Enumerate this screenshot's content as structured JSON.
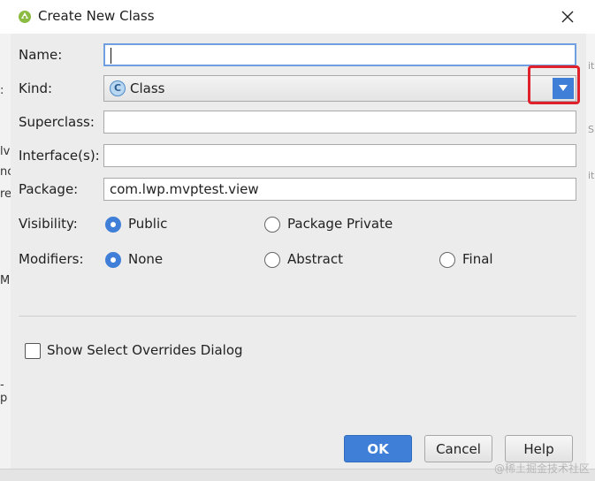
{
  "window": {
    "title": "Create New Class"
  },
  "form": {
    "name": {
      "label": "Name:",
      "value": ""
    },
    "kind": {
      "label": "Kind:",
      "value": "Class",
      "icon": "class-icon"
    },
    "superclass": {
      "label": "Superclass:",
      "value": ""
    },
    "interfaces": {
      "label": "Interface(s):",
      "value": ""
    },
    "package": {
      "label": "Package:",
      "value": "com.lwp.mvptest.view"
    },
    "visibility": {
      "label": "Visibility:",
      "options": [
        "Public",
        "Package Private"
      ],
      "selected": "Public"
    },
    "modifiers": {
      "label": "Modifiers:",
      "options": [
        "None",
        "Abstract",
        "Final"
      ],
      "selected": "None"
    }
  },
  "overrides_checkbox": {
    "label": "Show Select Overrides Dialog",
    "checked": false
  },
  "buttons": {
    "ok": "OK",
    "cancel": "Cancel",
    "help": "Help"
  },
  "background_text": {
    "left": [
      ":",
      "lv",
      "nc",
      "re",
      "M",
      "-p"
    ],
    "right": [
      "it",
      "S",
      "it"
    ]
  },
  "watermark": "@稀土掘金技术社区",
  "colors": {
    "accent": "#3f7fd7",
    "highlight": "#e0202a"
  }
}
